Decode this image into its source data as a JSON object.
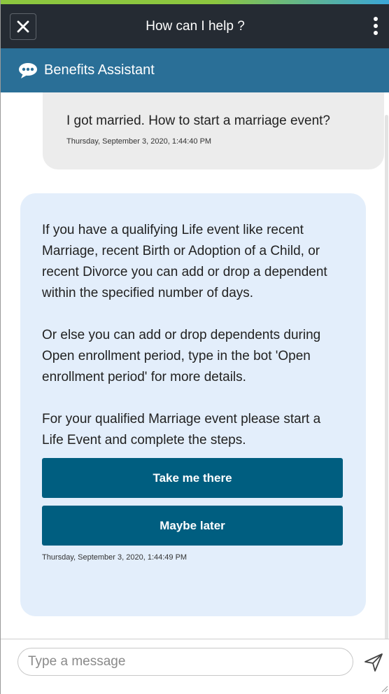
{
  "header": {
    "title": "How can I help ?",
    "close_icon": "close-icon",
    "menu_icon": "more-vertical-icon"
  },
  "assistant": {
    "label": "Benefits Assistant",
    "icon": "chat-bubble-icon"
  },
  "messages": {
    "user": {
      "text": "I got married. How to start a marriage event?",
      "timestamp": "Thursday, September 3, 2020, 1:44:40 PM"
    },
    "bot": {
      "paragraphs": [
        "If you have a qualifying Life event like recent Marriage, recent Birth or Adoption of a Child, or recent Divorce you can add or drop a dependent within the specified number of days.",
        "Or else you can add or drop dependents during Open enrollment period, type in the bot 'Open enrollment period' for more details.",
        "For your qualified Marriage event please start a Life Event and complete the steps."
      ],
      "buttons": [
        "Take me there",
        "Maybe later"
      ],
      "timestamp": "Thursday, September 3, 2020, 1:44:49 PM"
    }
  },
  "composer": {
    "placeholder": "Type a message",
    "send_icon": "send-icon"
  },
  "colors": {
    "header_bg": "#252b33",
    "assistant_bar": "#2a6f97",
    "button_bg": "#005e80",
    "bot_bubble": "#e3eefb",
    "user_bubble": "#ececec"
  }
}
